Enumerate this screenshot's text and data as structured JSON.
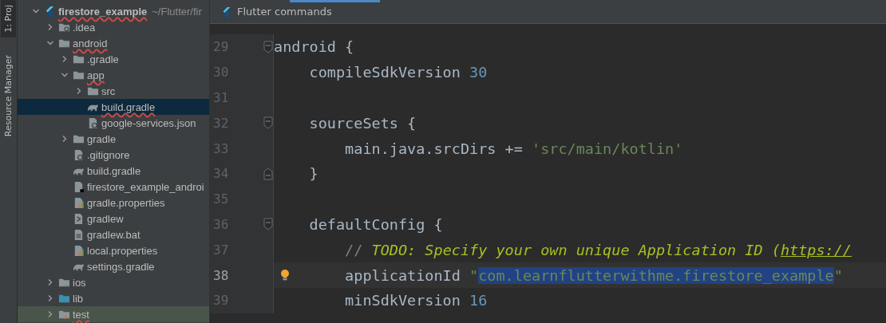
{
  "tool_strip": {
    "project_tab": {
      "label": "1: Proj",
      "selected": true
    },
    "resource_tab": {
      "label": "Resource Manager",
      "selected": false
    }
  },
  "project_tree": [
    {
      "name": "firestore_example",
      "path": "~/Flutter/fir",
      "kind": "flutter",
      "expanded": true,
      "misspelled": true,
      "selected": false,
      "children": [
        {
          "name": ".idea",
          "kind": "settings-folder",
          "expanded": false,
          "misspelled": false,
          "selected": false
        },
        {
          "name": "android",
          "kind": "module-folder",
          "expanded": true,
          "misspelled": true,
          "selected": false,
          "children": [
            {
              "name": ".gradle",
              "kind": "folder",
              "expanded": false,
              "misspelled": false,
              "selected": false
            },
            {
              "name": "app",
              "kind": "folder",
              "expanded": true,
              "misspelled": true,
              "selected": false,
              "children": [
                {
                  "name": "src",
                  "kind": "folder",
                  "expanded": false,
                  "misspelled": false,
                  "selected": false
                },
                {
                  "name": "build.gradle",
                  "kind": "gradle",
                  "misspelled": true,
                  "selected": true
                },
                {
                  "name": "google-services.json",
                  "kind": "json",
                  "misspelled": false,
                  "selected": false
                }
              ]
            },
            {
              "name": "gradle",
              "kind": "folder",
              "expanded": false,
              "misspelled": false,
              "selected": false
            },
            {
              "name": ".gitignore",
              "kind": "gitignore",
              "misspelled": false,
              "selected": false
            },
            {
              "name": "build.gradle",
              "kind": "gradle",
              "misspelled": false,
              "selected": false
            },
            {
              "name": "firestore_example_androi",
              "kind": "module-file",
              "misspelled": false,
              "selected": false
            },
            {
              "name": "gradle.properties",
              "kind": "properties",
              "misspelled": false,
              "selected": false
            },
            {
              "name": "gradlew",
              "kind": "script",
              "misspelled": false,
              "selected": false
            },
            {
              "name": "gradlew.bat",
              "kind": "text",
              "misspelled": false,
              "selected": false
            },
            {
              "name": "local.properties",
              "kind": "properties",
              "misspelled": false,
              "selected": false
            },
            {
              "name": "settings.gradle",
              "kind": "gradle",
              "misspelled": false,
              "selected": false
            }
          ]
        },
        {
          "name": "ios",
          "kind": "module-folder",
          "expanded": false,
          "misspelled": false,
          "selected": false
        },
        {
          "name": "lib",
          "kind": "source-folder",
          "expanded": false,
          "misspelled": false,
          "selected": false
        },
        {
          "name": "test",
          "kind": "test-folder",
          "expanded": false,
          "misspelled": true,
          "selected": false
        }
      ]
    }
  ],
  "editor": {
    "header": "Flutter commands",
    "lines": [
      {
        "number": "29",
        "kind": "block-start",
        "current": false,
        "bulb": false,
        "tokens": [
          {
            "kind": "plain",
            "text": "android {"
          }
        ]
      },
      {
        "number": "30",
        "kind": "plain",
        "current": false,
        "bulb": false,
        "tokens": [
          {
            "kind": "plain",
            "text": "    compileSdkVersion "
          },
          {
            "kind": "number",
            "text": "30"
          }
        ]
      },
      {
        "number": "31",
        "kind": "plain",
        "current": false,
        "bulb": false
      },
      {
        "number": "32",
        "kind": "block-start",
        "current": false,
        "bulb": false,
        "tokens": [
          {
            "kind": "plain",
            "text": "    sourceSets {"
          }
        ]
      },
      {
        "number": "33",
        "kind": "plain",
        "current": false,
        "bulb": false,
        "tokens": [
          {
            "kind": "plain",
            "text": "        main.java.srcDirs += "
          },
          {
            "kind": "string",
            "text": "'src/main/kotlin'"
          }
        ]
      },
      {
        "number": "34",
        "kind": "block-end",
        "current": false,
        "bulb": false,
        "tokens": [
          {
            "kind": "plain",
            "text": "    }"
          }
        ]
      },
      {
        "number": "35",
        "kind": "plain",
        "current": false,
        "bulb": false
      },
      {
        "number": "36",
        "kind": "block-start",
        "current": false,
        "bulb": false,
        "tokens": [
          {
            "kind": "plain",
            "text": "    defaultConfig {"
          }
        ]
      },
      {
        "number": "37",
        "kind": "plain",
        "current": false,
        "bulb": false,
        "tokens": [
          {
            "kind": "comment",
            "text": "        // "
          },
          {
            "kind": "todo",
            "text": "TODO: Specify your own unique Application ID ("
          },
          {
            "kind": "link",
            "text": "https://"
          }
        ]
      },
      {
        "number": "38",
        "kind": "plain",
        "current": true,
        "bulb": true,
        "tokens": [
          {
            "kind": "plain",
            "text": "        applicationId "
          },
          {
            "kind": "quote",
            "text": "\""
          },
          {
            "kind": "selection",
            "text": "com.learnflutterwithme.firestore_example"
          },
          {
            "kind": "quote",
            "text": "\""
          }
        ]
      },
      {
        "number": "39",
        "kind": "plain",
        "current": false,
        "bulb": false,
        "tokens": [
          {
            "kind": "plain",
            "text": "        minSdkVersion "
          },
          {
            "kind": "number",
            "text": "16"
          }
        ]
      }
    ]
  }
}
